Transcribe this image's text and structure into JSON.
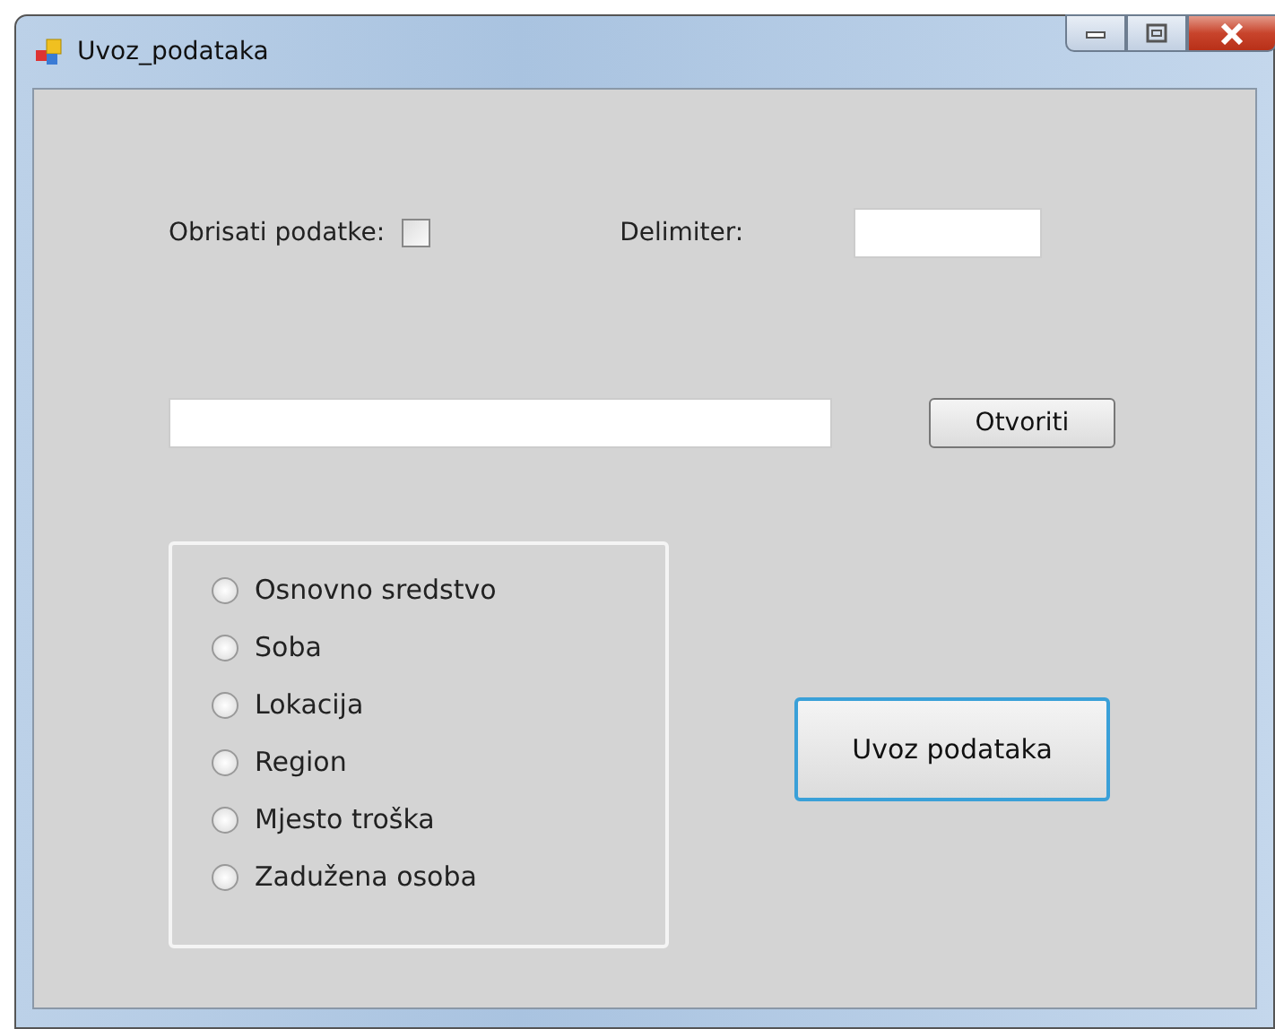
{
  "window": {
    "title": "Uvoz_podataka"
  },
  "delete_data": {
    "label": "Obrisati podatke:",
    "checked": false
  },
  "delimiter": {
    "label": "Delimiter:"
  },
  "open_button": {
    "label": "Otvoriti"
  },
  "options": [
    {
      "label": "Osnovno sredstvo",
      "selected": false
    },
    {
      "label": "Soba",
      "selected": false
    },
    {
      "label": "Lokacija",
      "selected": false
    },
    {
      "label": "Region",
      "selected": false
    },
    {
      "label": "Mjesto troška",
      "selected": false
    },
    {
      "label": "Zadužena osoba",
      "selected": false
    }
  ],
  "import_button": {
    "label": "Uvoz podataka"
  }
}
